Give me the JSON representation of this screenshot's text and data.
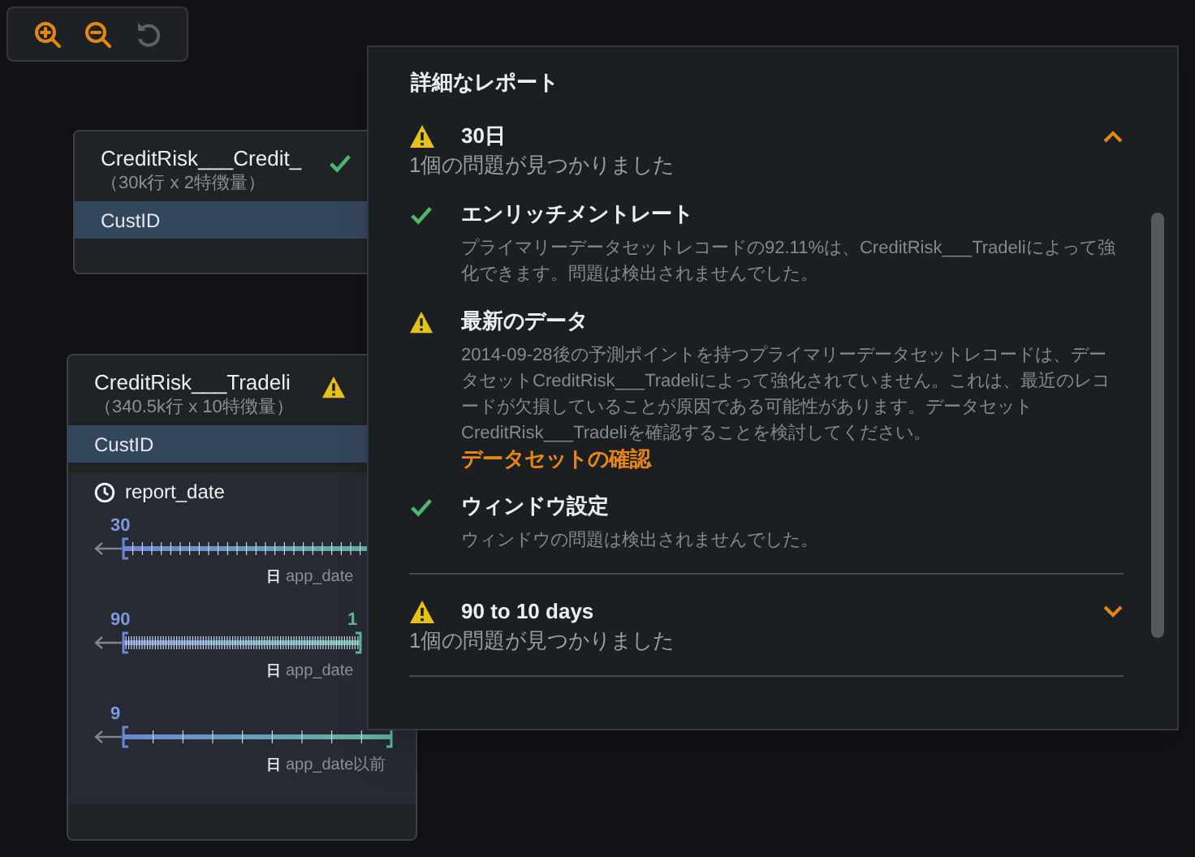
{
  "toolbar": {
    "buttons": [
      {
        "kind": "zoom_in",
        "disabled": false
      },
      {
        "kind": "zoom_out",
        "disabled": false
      },
      {
        "kind": "reset",
        "disabled": true
      }
    ]
  },
  "datasets": [
    {
      "name": "CreditRisk___Credit_",
      "size": "（30k行 x 2特徴量）",
      "kind": "ok",
      "key": "CustID"
    },
    {
      "name": "CreditRisk___Tradeli",
      "size": "（340.5k行 x 10特徴量）",
      "kind": "warning",
      "key": "CustID",
      "date_feature": "report_date",
      "windows": [
        {
          "start": "30",
          "caption_icon": "日",
          "caption": "app_date"
        },
        {
          "start": "90",
          "end": "1",
          "caption_icon": "日",
          "caption": "app_date"
        },
        {
          "start": "9",
          "caption_icon": "日",
          "caption": "app_date以前"
        }
      ]
    }
  ],
  "report": {
    "title": "詳細なレポート",
    "sections": [
      {
        "title": "30日",
        "kind": "warning",
        "expanded": true,
        "summary": "1個の問題が見つかりました",
        "checks": [
          {
            "kind": "ok",
            "title": "エンリッチメントレート",
            "text": "プライマリーデータセットレコードの92.11%は、CreditRisk___Tradeliによって強化できます。問題は検出されませんでした。"
          },
          {
            "kind": "warning",
            "title": "最新のデータ",
            "text": "2014-09-28後の予測ポイントを持つプライマリーデータセットレコードは、データセットCreditRisk___Tradeliによって強化されていません。これは、最近のレコードが欠損していることが原因である可能性があります。データセットCreditRisk___Tradeliを確認することを検討してください。",
            "link": "データセットの確認"
          },
          {
            "kind": "ok",
            "title": "ウィンドウ設定",
            "text": "ウィンドウの問題は検出されませんでした。"
          }
        ]
      },
      {
        "title": "90 to 10 days",
        "kind": "warning",
        "expanded": false,
        "summary": "1個の問題が見つかりました"
      }
    ]
  }
}
